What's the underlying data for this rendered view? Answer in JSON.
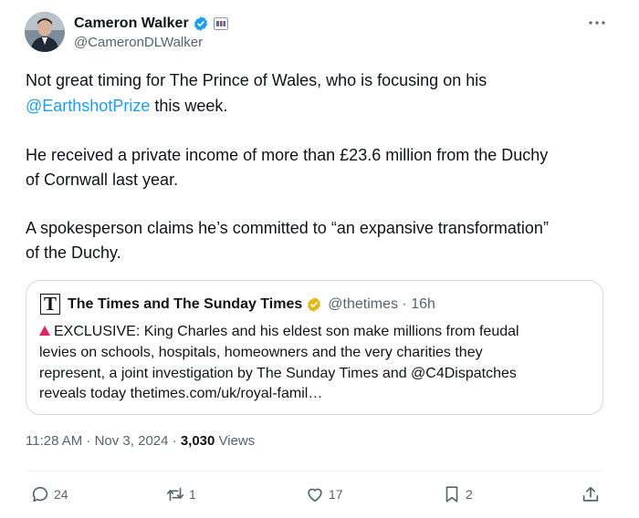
{
  "author": {
    "name": "Cameron Walker",
    "handle": "@CameronDLWalker"
  },
  "tweet": {
    "lines": [
      {
        "pre": "Not great timing for The Prince of Wales, who is focusing on his",
        "link": "",
        "post": ""
      },
      {
        "pre": "",
        "link": "@EarthshotPrize",
        "post": " this week."
      },
      {
        "pre": "He received a private income of more than £23.6 million from the Duchy",
        "link": "",
        "post": ""
      },
      {
        "pre": "of Cornwall last year.",
        "link": "",
        "post": ""
      },
      {
        "pre": "A spokesperson claims he’s committed to “an expansive transformation”",
        "link": "",
        "post": ""
      },
      {
        "pre": "of the Duchy.",
        "link": "",
        "post": ""
      }
    ]
  },
  "quote": {
    "logo_letter": "T",
    "name": "The Times and The Sunday Times",
    "handle_time": "@thetimes · 16h",
    "lines": [
      "EXCLUSIVE: King Charles and his eldest son make millions from feudal",
      "levies on schools, hospitals, homeowners and the very charities they",
      "represent, a joint investigation by The Sunday Times and @C4Dispatches",
      "reveals today  thetimes.com/uk/royal-famil…"
    ]
  },
  "meta": {
    "time_date": "11:28 AM · Nov 3, 2024 · ",
    "views_count": "3,030",
    "views_label": " Views"
  },
  "actions": {
    "replies": "24",
    "reposts": "1",
    "likes": "17",
    "bookmarks": "2"
  },
  "colors": {
    "link": "#1d9bf0",
    "verified_blue": "#1d9bf0",
    "verified_gold": "#e2b719",
    "secondary_text": "#536471"
  },
  "icons": [
    "verified-badge-icon",
    "affiliate-badge-icon",
    "more-icon",
    "reply-icon",
    "repost-icon",
    "like-icon",
    "bookmark-icon",
    "share-icon"
  ]
}
